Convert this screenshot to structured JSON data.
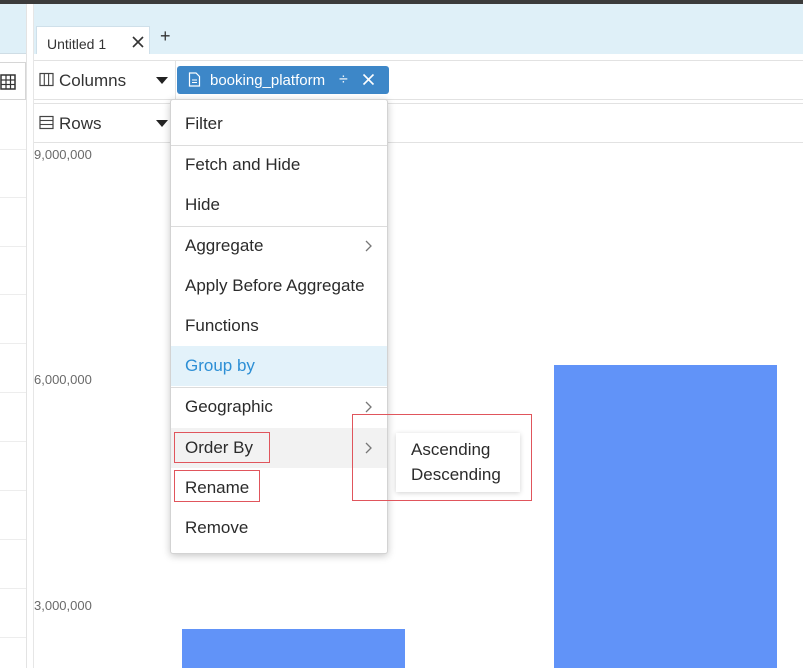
{
  "tabs": [
    {
      "label": "Untitled 1"
    }
  ],
  "tab_add_label": "+",
  "shelves": {
    "columns": {
      "label": "Columns"
    },
    "rows": {
      "label": "Rows"
    }
  },
  "pill": {
    "label": "booking_platform",
    "drag_glyph": "÷"
  },
  "chart_data": {
    "type": "bar",
    "categories": [],
    "values": [
      2700000,
      6200000
    ],
    "ylim": [
      0,
      9000000
    ],
    "yticks": [
      "9,000,000",
      "6,000,000",
      "3,000,000"
    ],
    "colors": {
      "bar": "#6193f8"
    }
  },
  "menu": {
    "items": [
      {
        "label": "Filter"
      },
      {
        "label": "Fetch and Hide"
      },
      {
        "label": "Hide"
      },
      {
        "label": "Aggregate"
      },
      {
        "label": "Apply Before Aggregate"
      },
      {
        "label": "Functions"
      },
      {
        "label": "Group by"
      },
      {
        "label": "Geographic"
      },
      {
        "label": "Order By"
      },
      {
        "label": "Rename"
      },
      {
        "label": "Remove"
      }
    ]
  },
  "submenu": {
    "items": [
      {
        "label": "Ascending"
      },
      {
        "label": "Descending"
      }
    ]
  },
  "colors": {
    "accent": "#3d87c8",
    "active_text": "#2d8fd5",
    "highlight": "#e0555c"
  }
}
